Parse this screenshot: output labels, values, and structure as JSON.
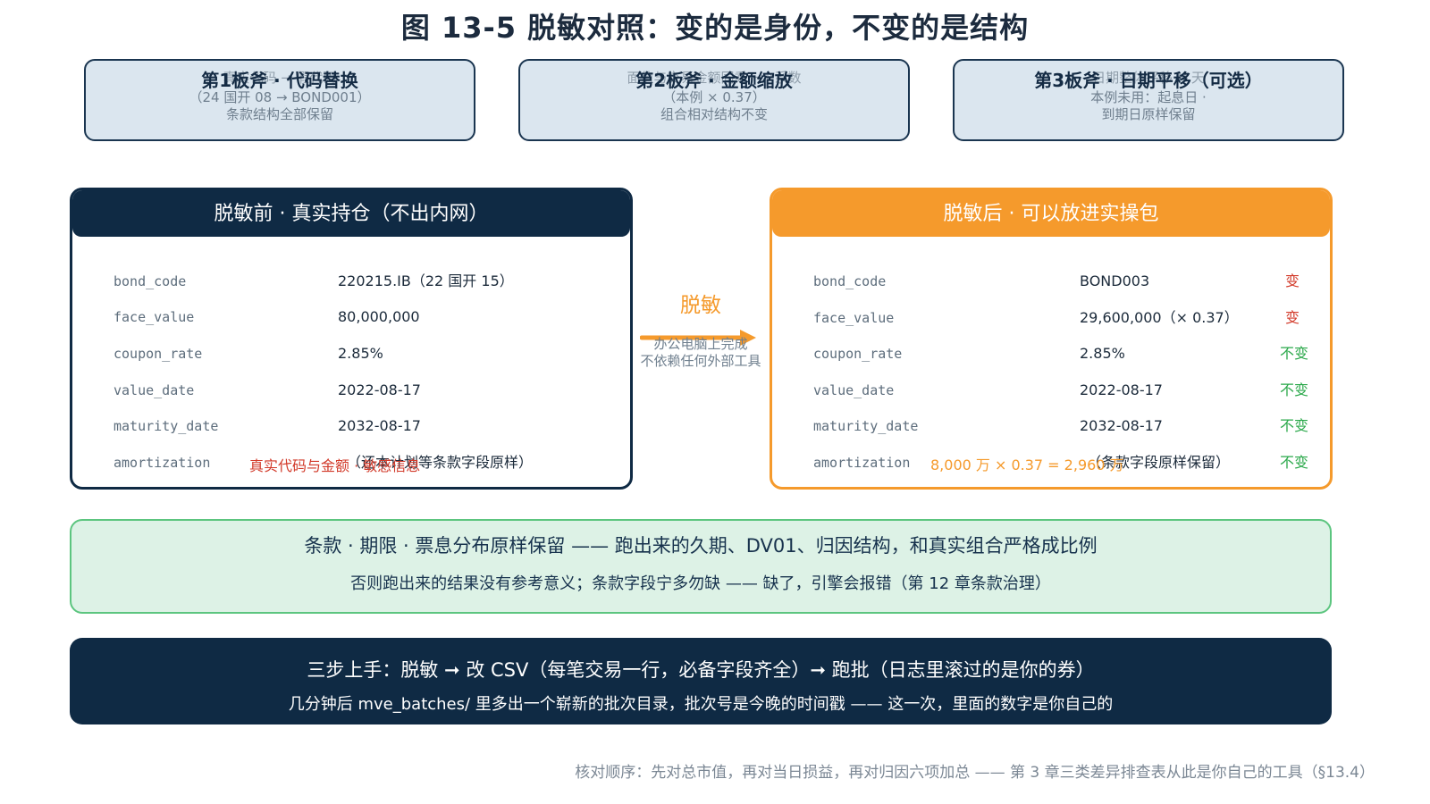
{
  "title": "图 13-5 脱敏对照：变的是身份，不变的是结构",
  "axes": [
    {
      "heading": "第1板斧 · 代码替换",
      "ghost": "真实代码 → 假代码",
      "line2": "（24 国开 08 → BOND001）",
      "line3": "条款结构全部保留"
    },
    {
      "heading": "第2板斧 · 金额缩放",
      "ghost": "面值与交易金额同乘一个系数",
      "line2": "（本例 × 0.37）",
      "line3": "组合相对结构不变"
    },
    {
      "heading": "第3板斧 · 日期平移（可选）",
      "ghost": "日期整体平移 N 天",
      "line2": "本例未用：起息日 ·",
      "line3": "到期日原样保留"
    }
  ],
  "before": {
    "header": "脱敏前 · 真实持仓（不出内网）",
    "rows": [
      {
        "key": "bond_code",
        "value": "220215.IB（22 国开 15）"
      },
      {
        "key": "face_value",
        "value": "80,000,000"
      },
      {
        "key": "coupon_rate",
        "value": "2.85%"
      },
      {
        "key": "value_date",
        "value": "2022-08-17"
      },
      {
        "key": "maturity_date",
        "value": "2032-08-17"
      },
      {
        "key": "amortization",
        "value": "（还本计划等条款字段原样）"
      }
    ],
    "overlay": "真实代码与金额 · 敏感信息"
  },
  "middle": {
    "label": "脱敏",
    "sub1": "办公电脑上完成",
    "sub2": "不依赖任何外部工具",
    "arrow_color": "#f59a2c"
  },
  "after": {
    "header": "脱敏后 · 可以放进实操包",
    "rows": [
      {
        "key": "bond_code",
        "value": "BOND003",
        "tag": "变",
        "changed": true
      },
      {
        "key": "face_value",
        "value": "29,600,000（× 0.37）",
        "tag": "变",
        "changed": true
      },
      {
        "key": "coupon_rate",
        "value": "2.85%",
        "tag": "不变",
        "changed": false
      },
      {
        "key": "value_date",
        "value": "2022-08-17",
        "tag": "不变",
        "changed": false
      },
      {
        "key": "maturity_date",
        "value": "2032-08-17",
        "tag": "不变",
        "changed": false
      },
      {
        "key": "amortization",
        "value": "（条款字段原样保留）",
        "tag": "不变",
        "changed": false
      }
    ],
    "overlay": "8,000 万 × 0.37 = 2,960 万"
  },
  "green_box": {
    "line1": "条款 · 期限 · 票息分布原样保留 —— 跑出来的久期、DV01、归因结构，和真实组合严格成比例",
    "line2": "否则跑出来的结果没有参考意义；条款字段宁多勿缺 —— 缺了，引擎会报错（第 12 章条款治理）"
  },
  "navy_box": {
    "line1": "三步上手：脱敏 ➞ 改 CSV（每笔交易一行，必备字段齐全）➞ 跑批（日志里滚过的是你的券）",
    "line2": "几分钟后 mve_batches/ 里多出一个崭新的批次目录，批次号是今晚的时间戳 —— 这一次，里面的数字是你自己的"
  },
  "footer": "核对顺序：先对总市值，再对当日损益，再对归因六项加总 —— 第 3 章三类差异排查表从此是你自己的工具（§13.4）",
  "colors": {
    "navy": "#0f2a44",
    "orange": "#f59a2c",
    "green": "#5cc57f",
    "changed": "#d23a2a",
    "unchanged": "#2aa84a"
  }
}
